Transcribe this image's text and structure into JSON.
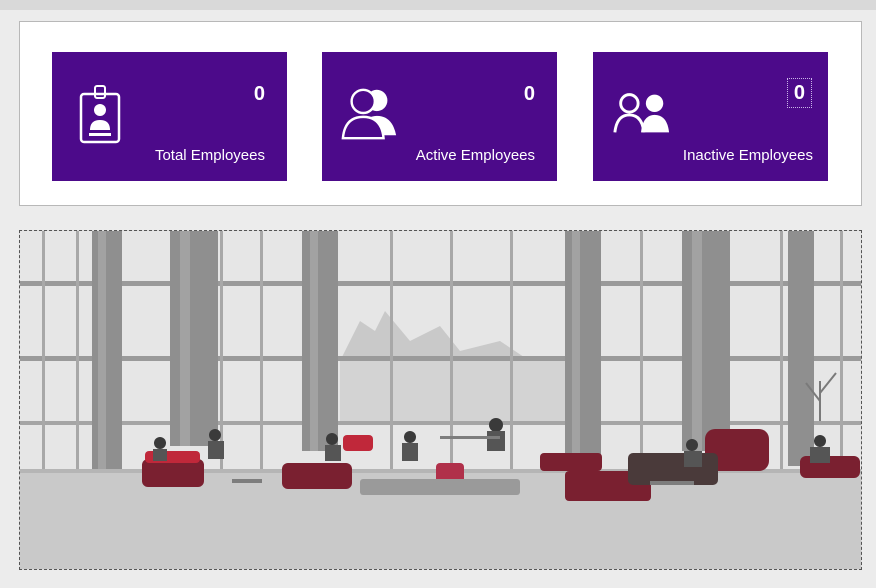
{
  "cards": [
    {
      "count": "0",
      "label": "Total Employees",
      "icon": "id-badge-icon"
    },
    {
      "count": "0",
      "label": "Active Employees",
      "icon": "users-icon"
    },
    {
      "count": "0",
      "label": "Inactive Employees",
      "icon": "user-group-icon"
    }
  ],
  "colors": {
    "card_bg": "#4c0a8a",
    "panel_bg": "#ffffff",
    "page_bg": "#ececec"
  },
  "image": {
    "subject": "lobby-photo"
  }
}
